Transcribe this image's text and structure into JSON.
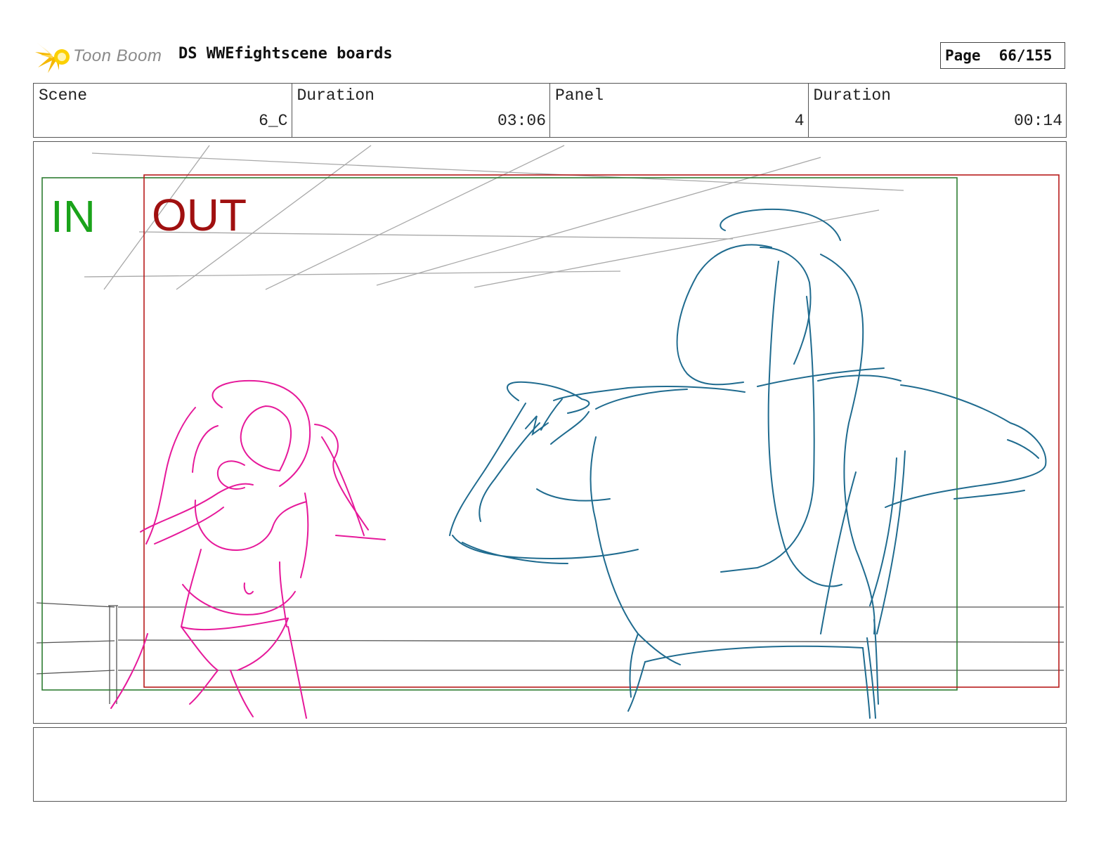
{
  "header": {
    "logo_text": "Toon Boom",
    "title": "DS WWEfightscene boards",
    "page_label": "Page",
    "page_value": "66/155"
  },
  "info": {
    "scene_label": "Scene",
    "scene_value": "6_C",
    "scene_duration_label": "Duration",
    "scene_duration_value": "03:06",
    "panel_label": "Panel",
    "panel_value": "4",
    "panel_duration_label": "Duration",
    "panel_duration_value": "00:14"
  },
  "panel": {
    "in_label": "IN",
    "out_label": "OUT",
    "in_color": "#1aa31a",
    "out_color": "#a01010",
    "in_frame_color": "#2e7d32",
    "out_frame_color": "#b71c1c",
    "left_figure_color": "#e6199a",
    "right_figure_color": "#1f6b8f"
  },
  "notes": {
    "text": ""
  }
}
